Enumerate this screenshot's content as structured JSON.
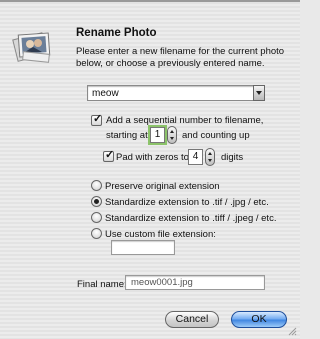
{
  "dialog": {
    "title": "Rename Photo",
    "description": "Please enter a new filename for the current photo below, or choose a previously entered name."
  },
  "filename_combo": {
    "value": "meow"
  },
  "sequential": {
    "checked": true,
    "label": "Add a sequential number to filename,",
    "start_label": "starting at:",
    "start_value": "1",
    "suffix_label": "and counting up",
    "pad": {
      "checked": true,
      "label": "Pad with zeros to",
      "digits_value": "4",
      "digits_label": "digits"
    }
  },
  "extension_options": [
    {
      "label": "Preserve original extension",
      "selected": false
    },
    {
      "label": "Standardize extension to .tif / .jpg / etc.",
      "selected": true
    },
    {
      "label": "Standardize extension to .tiff / .jpeg / etc.",
      "selected": false
    },
    {
      "label": "Use custom file extension:",
      "selected": false
    }
  ],
  "custom_extension": {
    "value": ""
  },
  "final_name": {
    "label": "Final name:",
    "value": "meow0001.jpg"
  },
  "buttons": {
    "cancel": "Cancel",
    "ok": "OK"
  },
  "colors": {
    "default_button": "#3d84e0",
    "focus_ring": "#8cc36a"
  },
  "icons": {
    "app": "photo-stack-icon",
    "grip": "resize-grip-icon"
  }
}
